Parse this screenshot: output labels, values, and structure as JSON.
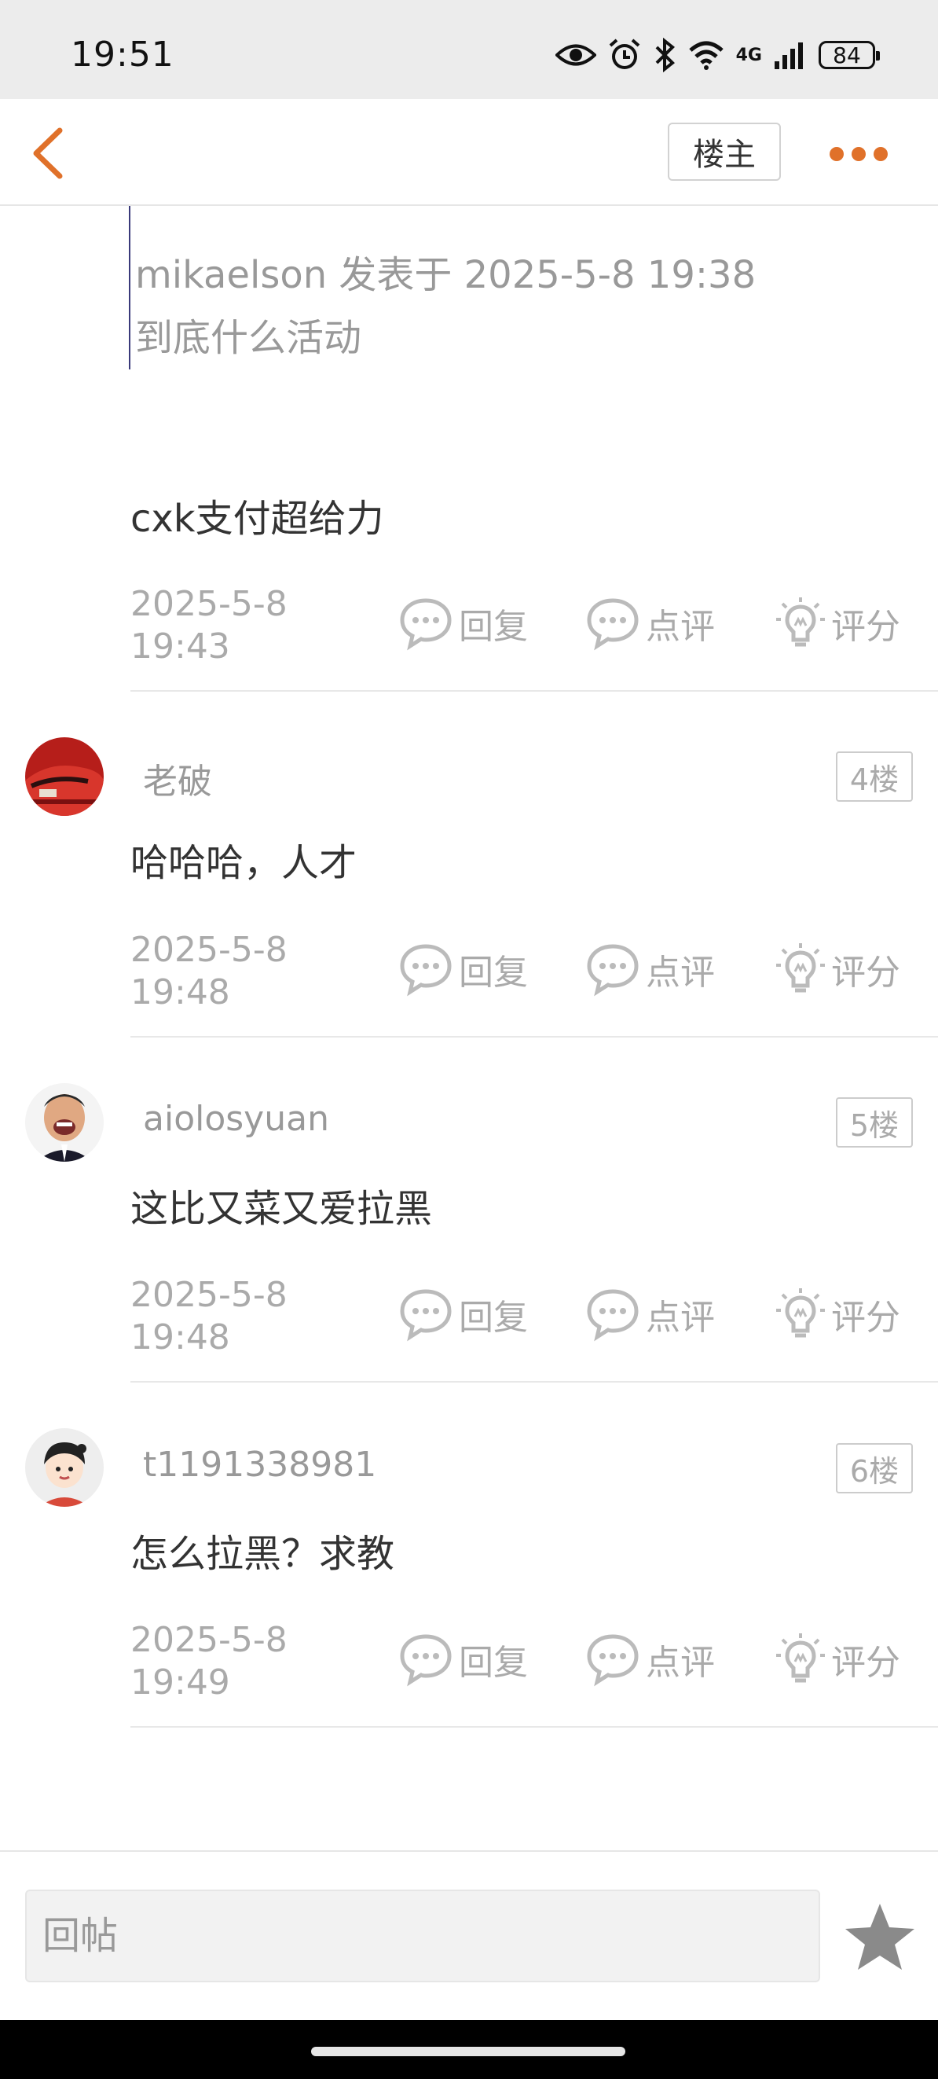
{
  "status": {
    "time": "19:51",
    "network": "4G",
    "battery": "84"
  },
  "nav": {
    "op_label": "楼主"
  },
  "quote": {
    "author_line": "mikaelson 发表于 2025-5-8 19:38",
    "text": "到底什么活动"
  },
  "actions": {
    "reply": "回复",
    "comment": "点评",
    "rate": "评分"
  },
  "posts": [
    {
      "text": "cxk支付超给力",
      "date": "2025-5-8",
      "time": "19:43"
    },
    {
      "username": "老破",
      "floor": "4楼",
      "text": "哈哈哈，人才",
      "date": "2025-5-8",
      "time": "19:48"
    },
    {
      "username": "aiolosyuan",
      "floor": "5楼",
      "text": "这比又菜又爱拉黑",
      "date": "2025-5-8",
      "time": "19:48"
    },
    {
      "username": "t1191338981",
      "floor": "6楼",
      "text": "怎么拉黑？求教",
      "date": "2025-5-8",
      "time": "19:49"
    }
  ],
  "bottom": {
    "reply_placeholder": "回帖"
  },
  "colors": {
    "accent": "#e0712a",
    "muted": "#aaaaaa"
  }
}
